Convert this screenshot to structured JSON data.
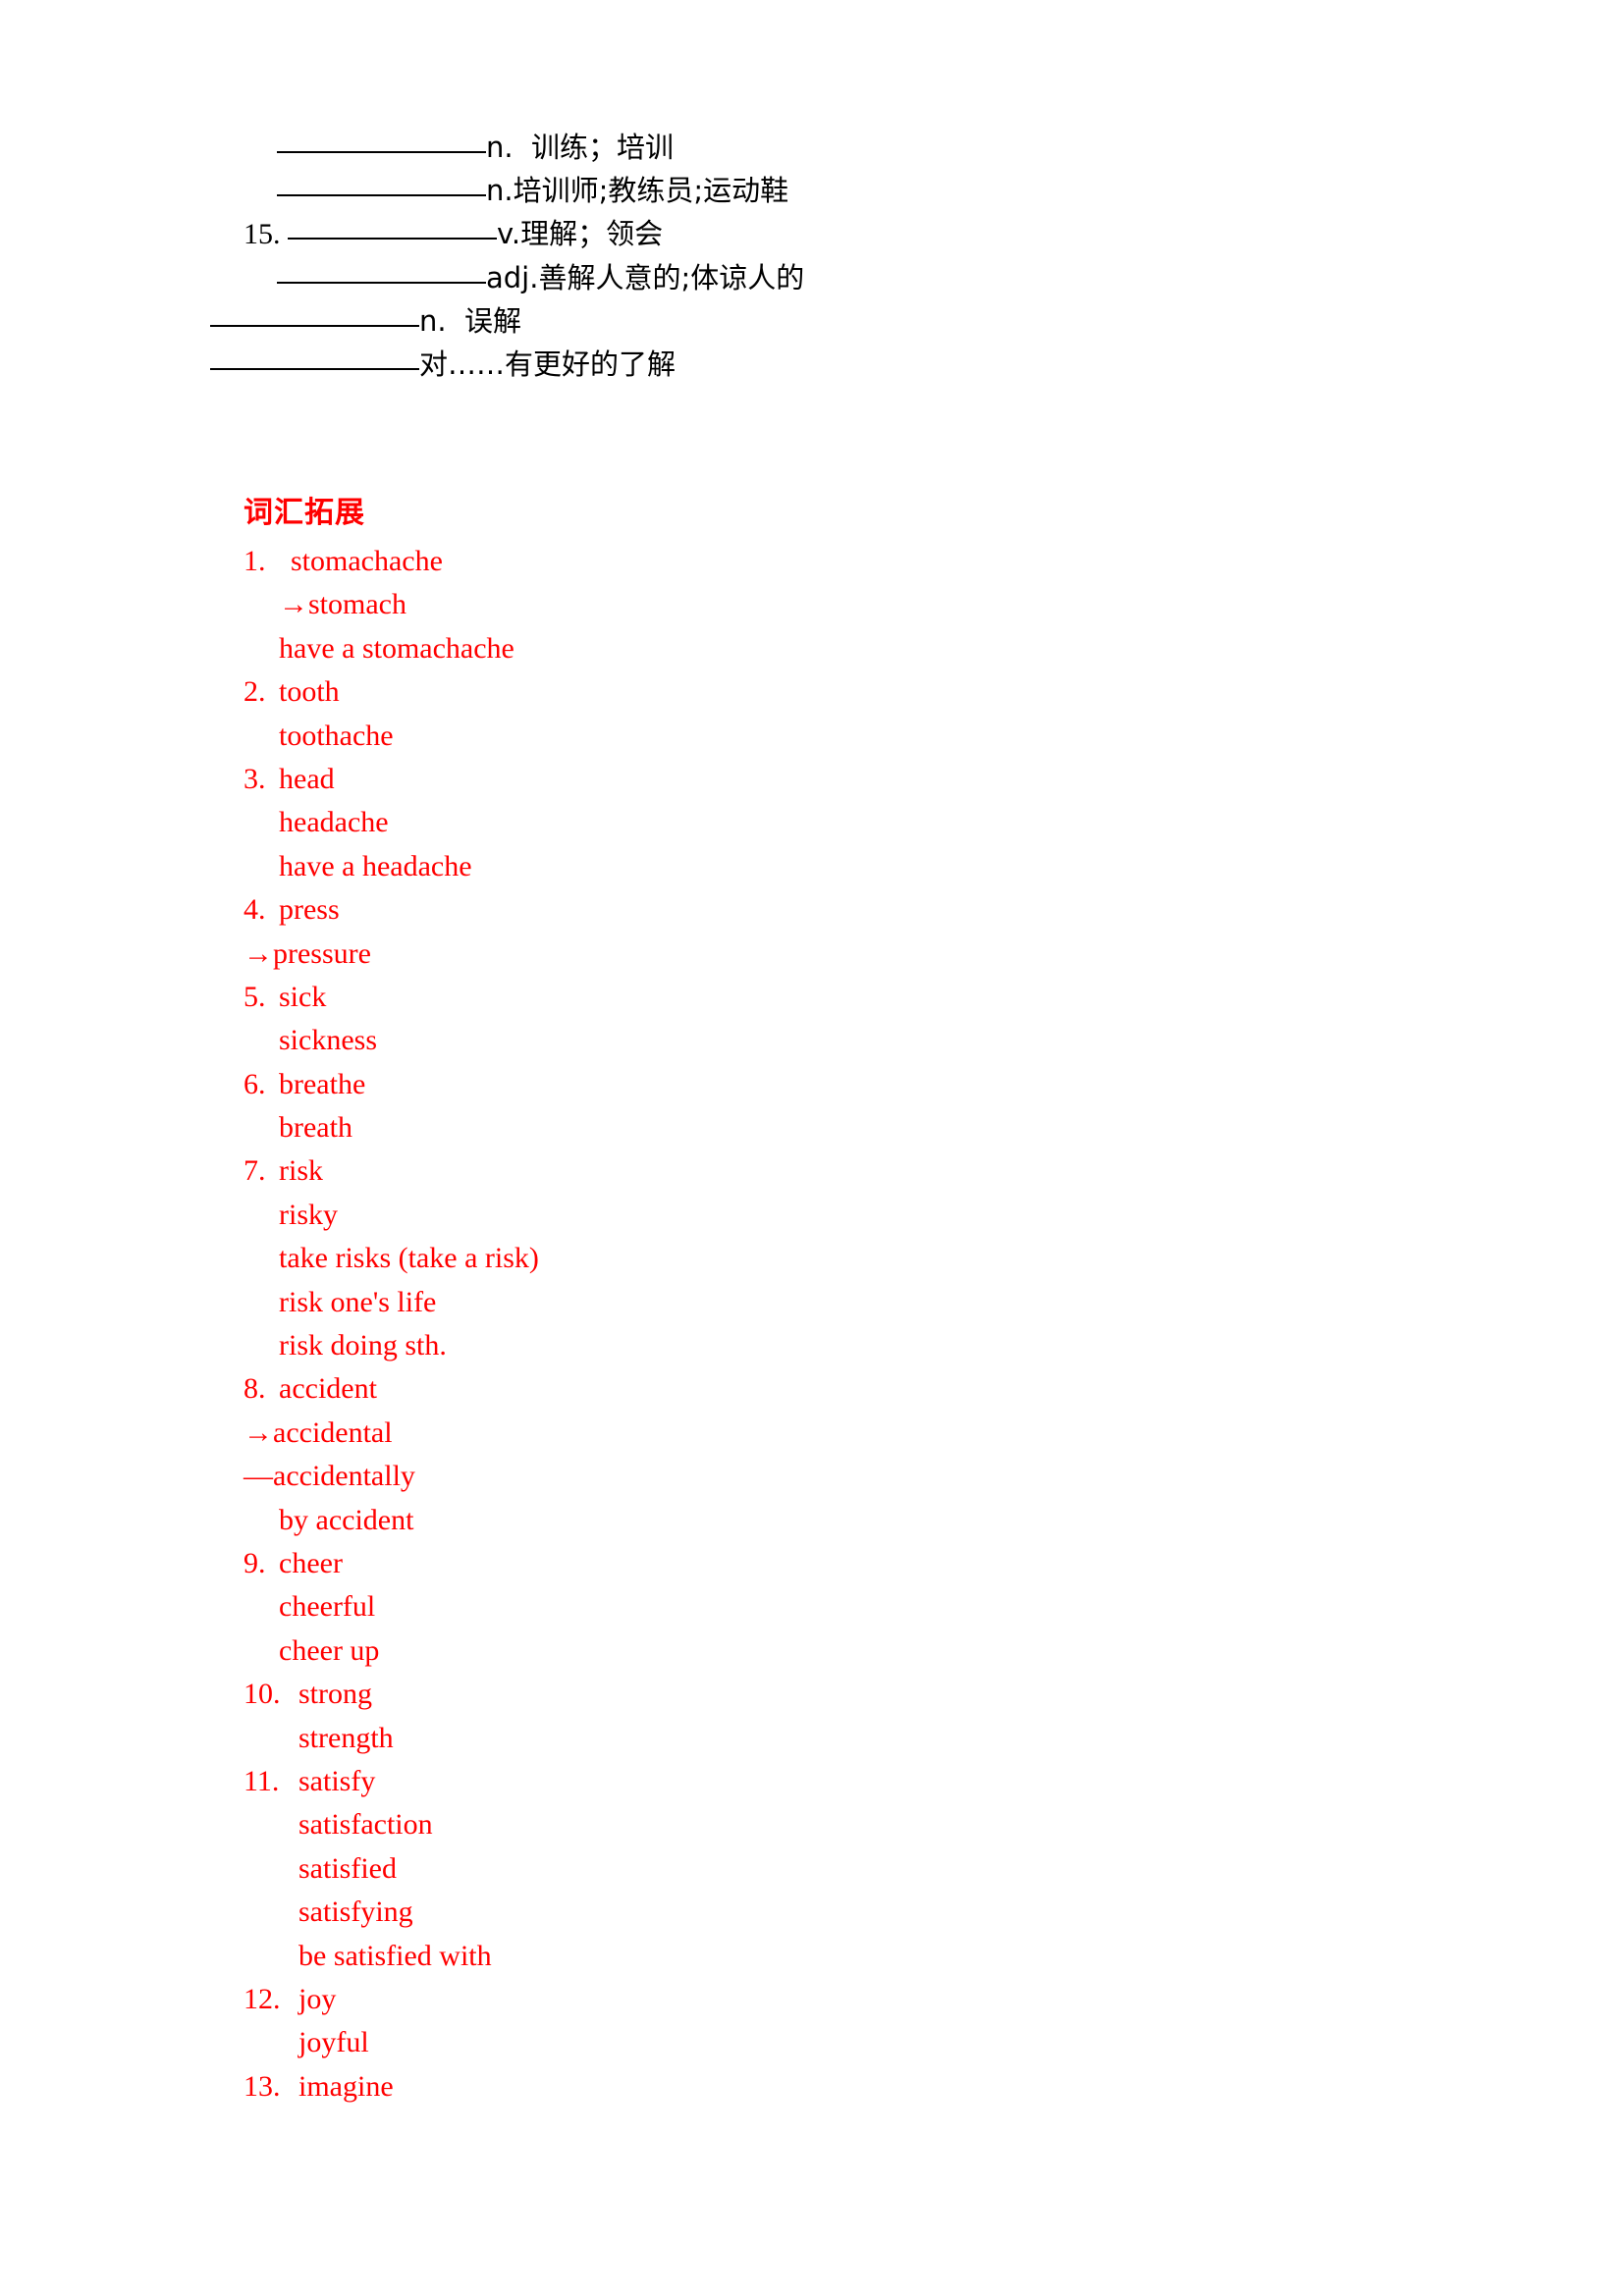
{
  "worksheet": {
    "blanks_section": {
      "lines": [
        {
          "number": "",
          "indent": true,
          "rule": true,
          "definition": "n.  训练；培训",
          "pos": "n."
        },
        {
          "number": "",
          "indent": true,
          "rule": true,
          "definition": "n.培训师;教练员;运动鞋",
          "pos": "n."
        },
        {
          "number": "15.",
          "indent": false,
          "rule": true,
          "definition": "v.理解；领会",
          "pos": "v."
        },
        {
          "number": "",
          "indent": true,
          "rule": true,
          "definition": "adj.善解人意的;体谅人的",
          "pos": "adj."
        },
        {
          "number": "",
          "indent": false,
          "flush": true,
          "rule": true,
          "definition": "n.  误解",
          "pos": "n."
        },
        {
          "number": "",
          "indent": false,
          "flush": true,
          "rule": true,
          "definition": "对……有更好的了解",
          "pos": ""
        }
      ]
    },
    "vocab_section": {
      "heading": "词汇拓展",
      "items": [
        {
          "number": "1.",
          "word": "stomachache",
          "subs": [
            {
              "marker": "→",
              "text": "stomach"
            },
            {
              "marker": "",
              "text": "have a stomachache"
            }
          ]
        },
        {
          "number": "2.",
          "word": "tooth",
          "subs": [
            {
              "marker": "",
              "text": "toothache"
            }
          ]
        },
        {
          "number": "3.",
          "word": "head",
          "subs": [
            {
              "marker": "",
              "text": "headache"
            },
            {
              "marker": "",
              "text": "have a headache"
            }
          ]
        },
        {
          "number": "4.",
          "word": "press",
          "subs": [
            {
              "marker": "→",
              "text": "pressure",
              "flush": true
            }
          ]
        },
        {
          "number": "5.",
          "word": "sick",
          "subs": [
            {
              "marker": "",
              "text": "sickness"
            }
          ]
        },
        {
          "number": "6.",
          "word": "breathe",
          "subs": [
            {
              "marker": "",
              "text": "breath"
            }
          ]
        },
        {
          "number": "7.",
          "word": "risk",
          "subs": [
            {
              "marker": "",
              "text": "risky"
            },
            {
              "marker": "",
              "text": "take risks (take a risk)"
            },
            {
              "marker": "",
              "text": "risk one's life"
            },
            {
              "marker": "",
              "text": "risk doing sth."
            }
          ]
        },
        {
          "number": "8.",
          "word": "accident",
          "subs": [
            {
              "marker": "→",
              "text": "accidental",
              "flush": true
            },
            {
              "marker": "—",
              "text": "accidentally",
              "flush": true
            },
            {
              "marker": "",
              "text": "by accident"
            }
          ]
        },
        {
          "number": "9.",
          "word": "cheer",
          "subs": [
            {
              "marker": "",
              "text": "cheerful"
            },
            {
              "marker": "",
              "text": "cheer up"
            }
          ]
        },
        {
          "number": "10.",
          "word": "strong",
          "wide": true,
          "subs": [
            {
              "marker": "",
              "text": "strength",
              "wide": true
            }
          ]
        },
        {
          "number": "11.",
          "word": "satisfy",
          "wide": true,
          "subs": [
            {
              "marker": "",
              "text": "satisfaction",
              "wide": true
            },
            {
              "marker": "",
              "text": "satisfied",
              "wide": true
            },
            {
              "marker": "",
              "text": "satisfying",
              "wide": true
            },
            {
              "marker": "",
              "text": "be satisfied with",
              "wide": true
            }
          ]
        },
        {
          "number": "12.",
          "word": "joy",
          "wide": true,
          "subs": [
            {
              "marker": "",
              "text": "joyful",
              "wide": true
            }
          ]
        },
        {
          "number": "13.",
          "word": "imagine",
          "wide": true,
          "subs": []
        }
      ]
    },
    "colors": {
      "red": "#ff0000",
      "black": "#000000",
      "page_background": "#ffffff"
    }
  }
}
